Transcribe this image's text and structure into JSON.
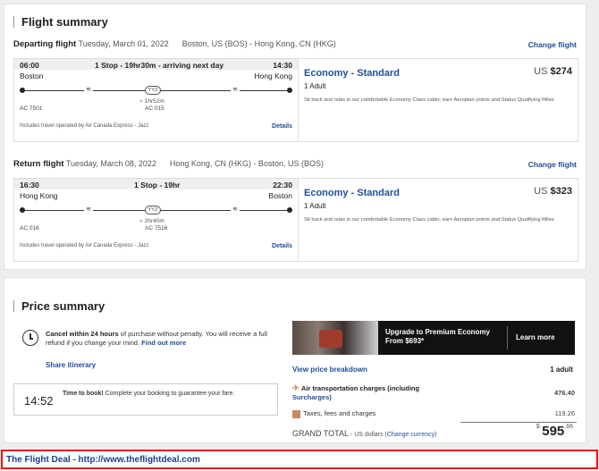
{
  "flight_summary": {
    "title": "Flight summary",
    "departing": {
      "label": "Departing flight",
      "date": "Tuesday, March 01, 2022",
      "route": "Boston, US (BOS) - Hong Kong, CN (HKG)",
      "change_link": "Change flight",
      "dep_time": "06:00",
      "stop_summary": "1 Stop - 19hr30m - arriving next day",
      "arr_time": "14:30",
      "origin": "Boston",
      "destination": "Hong Kong",
      "stop_code": "YYZ",
      "layover": "1hr52m",
      "flight_no_1": "AC 7501",
      "flight_no_2": "AC 015",
      "operated_by": "Includes travel operated by Air Canada Express - Jazz",
      "details_link": "Details",
      "cabin": "Economy - Standard",
      "price_currency": "US",
      "price": "$274",
      "passengers": "1 Adult",
      "cabin_desc": "Sit back and relax in our comfortable Economy Class cabin; earn Aeroplan points and Status Qualifying Miles"
    },
    "return": {
      "label": "Return flight",
      "date": "Tuesday, March 08, 2022",
      "route": "Hong Kong, CN (HKG) - Boston, US (BOS)",
      "change_link": "Change flight",
      "dep_time": "16:30",
      "stop_summary": "1 Stop - 19hr",
      "arr_time": "22:30",
      "origin": "Hong Kong",
      "destination": "Boston",
      "stop_code": "YYZ",
      "layover": "2hr40m",
      "flight_no_1": "AC 016",
      "flight_no_2": "AC 7516",
      "operated_by": "Includes travel operated by Air Canada Express - Jazz",
      "details_link": "Details",
      "cabin": "Economy - Standard",
      "price_currency": "US",
      "price": "$323",
      "passengers": "1 Adult",
      "cabin_desc": "Sit back and relax in our comfortable Economy Class cabin; earn Aeroplan points and Status Qualifying Miles"
    }
  },
  "price_summary": {
    "title": "Price summary",
    "cancel_bold": "Cancel within 24 hours",
    "cancel_rest": "of purchase without penalty. You will receive a full refund if you change your mind.",
    "find_out_more": "Find out more",
    "share_itinerary": "Share itinerary",
    "timer": "14:52",
    "timer_bold": "Time to book!",
    "timer_rest": "Complete your booking to guarantee your fare.",
    "promo_line1": "Upgrade to Premium Economy",
    "promo_line2": "From $693*",
    "promo_button": "Learn more",
    "breakdown_link": "View price breakdown",
    "breakdown_pax": "1 adult",
    "air_label": "Air transportation charges (including",
    "air_surcharges": "Surcharges)",
    "air_amount": "476.40",
    "taxes_label": "Taxes, fees and charges",
    "taxes_amount": "119.26",
    "grand_label": "GRAND TOTAL",
    "grand_sub": "- US dollars",
    "change_currency": "Change currency",
    "total_currency": "$",
    "total_whole": "595",
    "total_cents": ".66"
  },
  "footer": {
    "banner": "The Flight Deal - http://www.theflightdeal.com"
  },
  "icons": {
    "wifi": "wifi-icon",
    "clock": "clock-icon",
    "plane": "plane-icon",
    "taxes": "receipt-icon"
  },
  "colors": {
    "link_blue": "#1f4e99",
    "banner_border": "#ee1111",
    "banner_text": "#1f3d8f"
  }
}
